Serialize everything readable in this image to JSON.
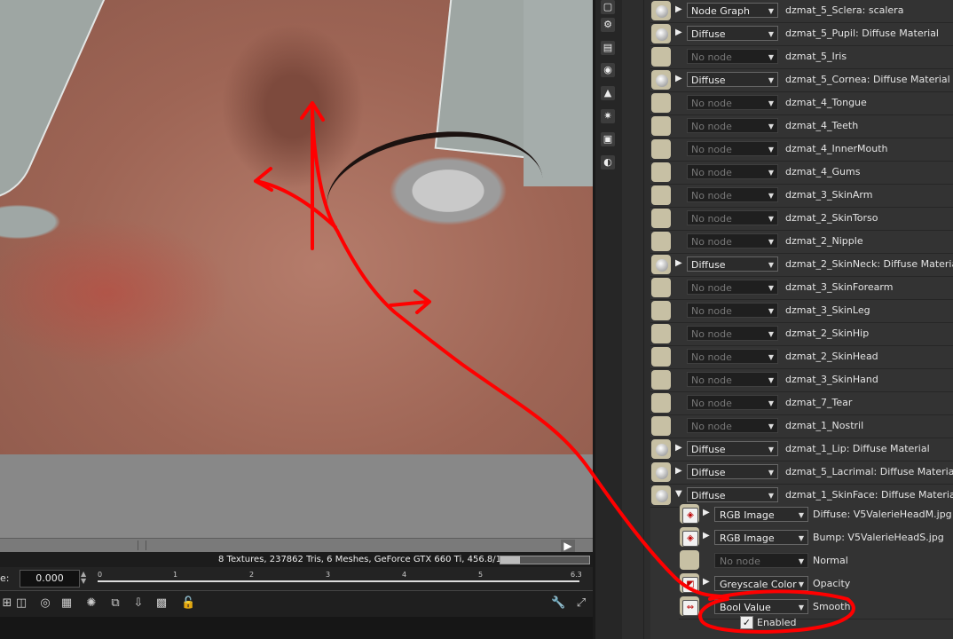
{
  "viewport": {
    "status": "8 Textures, 237862 Tris, 6 Meshes, GeForce GTX 660 Ti, 456.8/1086/2048 MB",
    "memory_fraction": 0.22
  },
  "timeline": {
    "frame_label": "e:",
    "frame_value": "0.000",
    "ticks": [
      "0",
      "1",
      "2",
      "3",
      "4",
      "5",
      "6.3"
    ]
  },
  "toolbar_icons": [
    "align-icon",
    "render-icon",
    "frame-icon",
    "progress-icon",
    "copy-icon",
    "paste-icon",
    "texture-icon",
    "lock-icon"
  ],
  "tools": [
    "wrench-icon",
    "expand-icon"
  ],
  "side_icons": [
    "object-icon",
    "camera-icon",
    "layer-icon",
    "database-icon",
    "image-icon",
    "light-icon",
    "render-settings-icon",
    "material-icon"
  ],
  "materials": [
    {
      "shader": "Node Graph",
      "expandable": true,
      "label": "dzmat_5_Sclera:  scalera"
    },
    {
      "shader": "Diffuse",
      "expandable": true,
      "label": "dzmat_5_Pupil:  Diffuse Material"
    },
    {
      "shader": "No node",
      "expandable": false,
      "label": "dzmat_5_Iris"
    },
    {
      "shader": "Diffuse",
      "expandable": true,
      "label": "dzmat_5_Cornea:  Diffuse Material"
    },
    {
      "shader": "No node",
      "expandable": false,
      "label": "dzmat_4_Tongue"
    },
    {
      "shader": "No node",
      "expandable": false,
      "label": "dzmat_4_Teeth"
    },
    {
      "shader": "No node",
      "expandable": false,
      "label": "dzmat_4_InnerMouth"
    },
    {
      "shader": "No node",
      "expandable": false,
      "label": "dzmat_4_Gums"
    },
    {
      "shader": "No node",
      "expandable": false,
      "label": "dzmat_3_SkinArm"
    },
    {
      "shader": "No node",
      "expandable": false,
      "label": "dzmat_2_SkinTorso"
    },
    {
      "shader": "No node",
      "expandable": false,
      "label": "dzmat_2_Nipple"
    },
    {
      "shader": "Diffuse",
      "expandable": true,
      "label": "dzmat_2_SkinNeck:  Diffuse Material"
    },
    {
      "shader": "No node",
      "expandable": false,
      "label": "dzmat_3_SkinForearm"
    },
    {
      "shader": "No node",
      "expandable": false,
      "label": "dzmat_3_SkinLeg"
    },
    {
      "shader": "No node",
      "expandable": false,
      "label": "dzmat_2_SkinHip"
    },
    {
      "shader": "No node",
      "expandable": false,
      "label": "dzmat_2_SkinHead"
    },
    {
      "shader": "No node",
      "expandable": false,
      "label": "dzmat_3_SkinHand"
    },
    {
      "shader": "No node",
      "expandable": false,
      "label": "dzmat_7_Tear"
    },
    {
      "shader": "No node",
      "expandable": false,
      "label": "dzmat_1_Nostril"
    },
    {
      "shader": "Diffuse",
      "expandable": true,
      "label": "dzmat_1_Lip:  Diffuse Material"
    },
    {
      "shader": "Diffuse",
      "expandable": true,
      "label": "dzmat_5_Lacrimal:  Diffuse Material"
    },
    {
      "shader": "Diffuse",
      "expandable": true,
      "expanded": true,
      "label": "dzmat_1_SkinFace:  Diffuse Material"
    }
  ],
  "skinface_params": [
    {
      "icon": "texture-icon",
      "shader": "RGB Image",
      "expandable": true,
      "label": "Diffuse:  V5ValerieHeadM.jpg"
    },
    {
      "icon": "texture-icon",
      "shader": "RGB Image",
      "expandable": true,
      "label": "Bump:  V5ValerieHeadS.jpg"
    },
    {
      "icon": "",
      "shader": "No node",
      "expandable": false,
      "label": "Normal"
    },
    {
      "icon": "greyscale-icon",
      "shader": "Greyscale Color",
      "expandable": true,
      "label": "Opacity"
    },
    {
      "icon": "bool-icon",
      "shader": "Bool Value",
      "expandable": false,
      "label": "Smooth"
    }
  ],
  "smooth_enabled": {
    "label": "Enabled",
    "checked": true,
    "mark": "✓"
  },
  "annotation_color": "#ff0000"
}
